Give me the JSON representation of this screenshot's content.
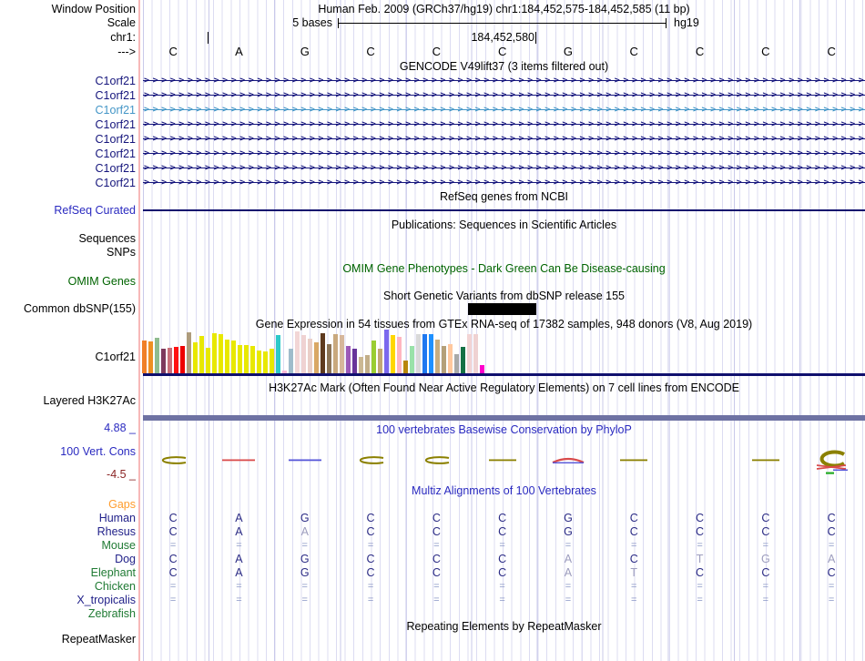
{
  "ruler": {
    "window_position_label": "Window Position",
    "window_value": "Human Feb. 2009 (GRCh37/hg19)   chr1:184,452,575-184,452,585 (11 bp)",
    "scale_label": "Scale",
    "scale_value": "5 bases",
    "assembly_short": "hg19",
    "chrom_label": "chr1:",
    "tick_label": "184,452,580",
    "strand_arrow": "--->",
    "bases": [
      "C",
      "A",
      "G",
      "C",
      "C",
      "C",
      "G",
      "C",
      "C",
      "C",
      "C"
    ]
  },
  "gencode": {
    "title": "GENCODE V49lift37 (3 items filtered out)",
    "genes": [
      {
        "label": "C1orf21",
        "highlight": false
      },
      {
        "label": "C1orf21",
        "highlight": false
      },
      {
        "label": "C1orf21",
        "highlight": true
      },
      {
        "label": "C1orf21",
        "highlight": false
      },
      {
        "label": "C1orf21",
        "highlight": false
      },
      {
        "label": "C1orf21",
        "highlight": false
      },
      {
        "label": "C1orf21",
        "highlight": false
      },
      {
        "label": "C1orf21",
        "highlight": false
      }
    ]
  },
  "refseq": {
    "title": "RefSeq genes from NCBI",
    "label": "RefSeq Curated"
  },
  "publications": {
    "title": "Publications: Sequences in Scientific Articles",
    "sequences_label": "Sequences",
    "snps_label": "SNPs"
  },
  "omim": {
    "title": "OMIM Gene Phenotypes - Dark Green Can Be Disease-causing",
    "label": "OMIM Genes"
  },
  "dbsnp": {
    "title": "Short Genetic Variants from dbSNP release 155",
    "label": "Common dbSNP(155)"
  },
  "gtex": {
    "title": "Gene Expression in 54 tissues from GTEx RNA-seq of 17382 samples, 948 donors (V8, Aug 2019)",
    "label": "C1orf21",
    "bars": [
      [
        "#F08028",
        36
      ],
      [
        "#EE9022",
        35
      ],
      [
        "#8FBC8F",
        39
      ],
      [
        "#7E3A5C",
        27
      ],
      [
        "#C86E78",
        28
      ],
      [
        "#FF1111",
        29
      ],
      [
        "#EE0000",
        30
      ],
      [
        "#AE9C7C",
        45
      ],
      [
        "#E8E800",
        34
      ],
      [
        "#E8E800",
        41
      ],
      [
        "#E8E800",
        28
      ],
      [
        "#E8E800",
        44
      ],
      [
        "#E8E800",
        43
      ],
      [
        "#E8E800",
        37
      ],
      [
        "#E8E800",
        36
      ],
      [
        "#E8E800",
        31
      ],
      [
        "#E8E800",
        31
      ],
      [
        "#E8E800",
        30
      ],
      [
        "#E8E800",
        25
      ],
      [
        "#E8E800",
        24
      ],
      [
        "#E8E800",
        27
      ],
      [
        "#2DC9C9",
        42
      ],
      [
        "#F9B7D7",
        3
      ],
      [
        "#9FBCCB",
        27
      ],
      [
        "#F2D6D6",
        46
      ],
      [
        "#EFD2D2",
        42
      ],
      [
        "#EACFC8",
        38
      ],
      [
        "#D9A865",
        34
      ],
      [
        "#5E3A1E",
        44
      ],
      [
        "#8B7355",
        32
      ],
      [
        "#C9A97E",
        43
      ],
      [
        "#D6B79B",
        42
      ],
      [
        "#9C59B8",
        30
      ],
      [
        "#68349A",
        27
      ],
      [
        "#CBB893",
        18
      ],
      [
        "#C2AE89",
        20
      ],
      [
        "#9ACD32",
        36
      ],
      [
        "#C3A875",
        27
      ],
      [
        "#7B68EE",
        48
      ],
      [
        "#FFD700",
        42
      ],
      [
        "#FFB6C1",
        40
      ],
      [
        "#B8860B",
        14
      ],
      [
        "#99E2A9",
        30
      ],
      [
        "#D9D9D9",
        43
      ],
      [
        "#1E78F0",
        43
      ],
      [
        "#1E90FF",
        43
      ],
      [
        "#C8AD7F",
        37
      ],
      [
        "#B5A079",
        30
      ],
      [
        "#FFC89E",
        32
      ],
      [
        "#A9A9A9",
        21
      ],
      [
        "#157145",
        29
      ],
      [
        "#F2D4D4",
        43
      ],
      [
        "#EFD2D2",
        43
      ],
      [
        "#FF00CC",
        9
      ]
    ]
  },
  "h3k27ac": {
    "title": "H3K27Ac Mark (Often Found Near Active Regulatory Elements) on 7 cell lines from ENCODE",
    "label": "Layered H3K27Ac",
    "band_color": "#6e72a3"
  },
  "phylop": {
    "title": "100 vertebrates Basewise Conservation by PhyloP",
    "label": "100 Vert. Cons",
    "max_label": "4.88 _",
    "min_label": "-4.5 _",
    "glyphs": [
      "flatC",
      "redLine",
      "blueLine",
      "flatC",
      "flatC",
      "oliveLine",
      "redArc",
      "oliveLine",
      "none",
      "oliveLine",
      "bigC"
    ]
  },
  "multiz": {
    "title": "Multiz Alignments of 100 Vertebrates",
    "rows": [
      {
        "label": "Gaps",
        "color": "orange",
        "cells": [
          "",
          "",
          "",
          "",
          "",
          "",
          "",
          "",
          "",
          "",
          ""
        ]
      },
      {
        "label": "Human",
        "color": "navy",
        "cells": [
          "C",
          "A",
          "G",
          "C",
          "C",
          "C",
          "G",
          "C",
          "C",
          "C",
          "C"
        ]
      },
      {
        "label": "Rhesus",
        "color": "navy",
        "cells": [
          "C",
          "A",
          "A*",
          "C",
          "C",
          "C",
          "G",
          "C",
          "C",
          "C",
          "C"
        ]
      },
      {
        "label": "Mouse",
        "color": "green",
        "cells": [
          "=",
          "=",
          "=",
          "=",
          "=",
          "=",
          "=",
          "=",
          "=",
          "=",
          "="
        ]
      },
      {
        "label": "Dog",
        "color": "navy",
        "cells": [
          "C",
          "A",
          "G",
          "C",
          "C",
          "C",
          "A*",
          "C",
          "T*",
          "G*",
          "A*"
        ]
      },
      {
        "label": "Elephant",
        "color": "green",
        "cells": [
          "C",
          "A",
          "G",
          "C",
          "C",
          "C",
          "A*",
          "T*",
          "C",
          "C",
          "C"
        ]
      },
      {
        "label": "Chicken",
        "color": "green",
        "cells": [
          "=",
          "=",
          "=",
          "=",
          "=",
          "=",
          "=",
          "=",
          "=",
          "=",
          "="
        ]
      },
      {
        "label": "X_tropicalis",
        "color": "navy",
        "cells": [
          "=",
          "=",
          "=",
          "=",
          "=",
          "=",
          "=",
          "=",
          "=",
          "=",
          "="
        ]
      },
      {
        "label": "Zebrafish",
        "color": "green",
        "cells": [
          "",
          "",
          "",
          "",
          "",
          "",
          "",
          "",
          "",
          "",
          ""
        ]
      }
    ]
  },
  "repeatmasker": {
    "title": "Repeating Elements by RepeatMasker",
    "label": "RepeatMasker"
  },
  "colors": {
    "gene_navy": "#15157c",
    "gene_highlight": "#4496c7",
    "separator_navy": "#10106e",
    "olive": "#8B8000",
    "glyph_red": "#d94a4a",
    "glyph_blue": "#5555d8",
    "glyph_green": "#22aa22"
  }
}
